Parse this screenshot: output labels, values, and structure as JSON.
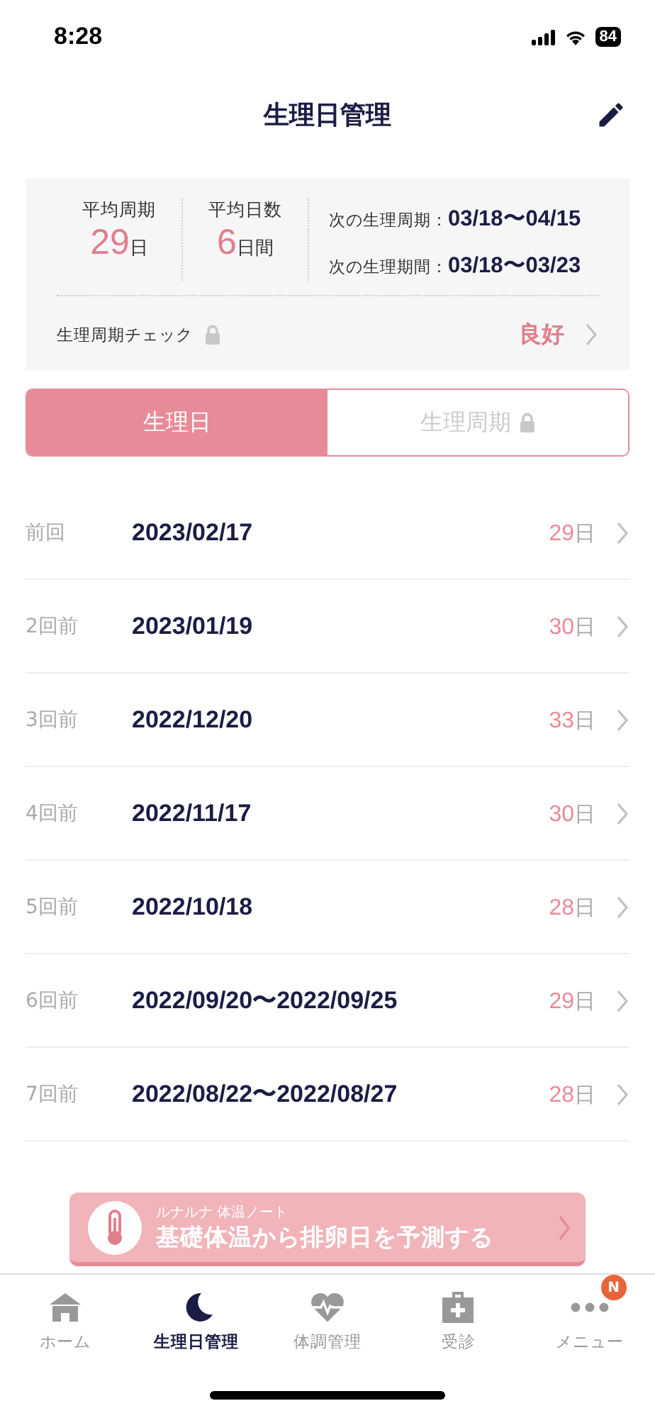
{
  "status_bar": {
    "time": "8:28",
    "battery": "84"
  },
  "header": {
    "title": "生理日管理"
  },
  "summary": {
    "stats": [
      {
        "label": "平均周期",
        "value": "29",
        "unit": "日"
      },
      {
        "label": "平均日数",
        "value": "6",
        "unit": "日間"
      }
    ],
    "forecasts": [
      {
        "label": "次の生理周期：",
        "value": "03/18〜04/15"
      },
      {
        "label": "次の生理期間：",
        "value": "03/18〜03/23"
      }
    ],
    "check": {
      "label": "生理周期チェック",
      "locked": true,
      "result": "良好"
    }
  },
  "tabs": [
    {
      "label": "生理日",
      "selected": true,
      "locked": false
    },
    {
      "label": "生理周期",
      "selected": false,
      "locked": true
    }
  ],
  "rows": [
    {
      "label": "前回",
      "date": "2023/02/17",
      "days": "29",
      "unit": "日"
    },
    {
      "label": "2回前",
      "date": "2023/01/19",
      "days": "30",
      "unit": "日"
    },
    {
      "label": "3回前",
      "date": "2022/12/20",
      "days": "33",
      "unit": "日"
    },
    {
      "label": "4回前",
      "date": "2022/11/17",
      "days": "30",
      "unit": "日"
    },
    {
      "label": "5回前",
      "date": "2022/10/18",
      "days": "28",
      "unit": "日"
    },
    {
      "label": "6回前",
      "date": "2022/09/20〜2022/09/25",
      "days": "29",
      "unit": "日"
    },
    {
      "label": "7回前",
      "date": "2022/08/22〜2022/08/27",
      "days": "28",
      "unit": "日"
    }
  ],
  "banner": {
    "subtitle": "ルナルナ 体温ノート",
    "title": "基礎体温から排卵日を予測する"
  },
  "tab_bar": [
    {
      "kind": "home",
      "label": "ホーム",
      "selected": false
    },
    {
      "kind": "moon",
      "label": "生理日管理",
      "selected": true
    },
    {
      "kind": "heart",
      "label": "体調管理",
      "selected": false
    },
    {
      "kind": "medical",
      "label": "受診",
      "selected": false
    },
    {
      "kind": "more",
      "label": "メニュー",
      "selected": false,
      "badge": "N"
    }
  ]
}
